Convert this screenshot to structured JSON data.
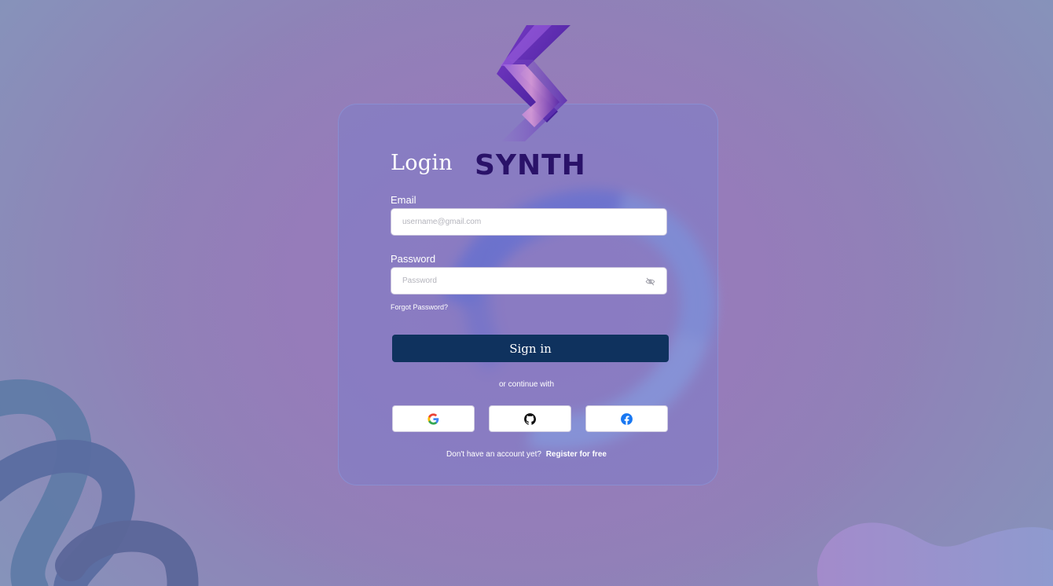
{
  "brand": {
    "name": "SYNTH",
    "logo_icon": "synth-s-logo-icon"
  },
  "login": {
    "title": "Login",
    "email_label": "Email",
    "email_placeholder": "username@gmail.com",
    "password_label": "Password",
    "password_placeholder": "Password",
    "password_toggle_icon": "eye-off-icon",
    "forgot_label": "Forgot Password?",
    "signin_label": "Sign in",
    "or_text": "or continue with",
    "social": [
      {
        "name": "Google",
        "icon": "google-icon"
      },
      {
        "name": "GitHub",
        "icon": "github-icon"
      },
      {
        "name": "Facebook",
        "icon": "facebook-icon"
      }
    ],
    "no_account_text": "Don't have an account yet?",
    "register_label": "Register for free"
  },
  "colors": {
    "primary_button": "#0f325e",
    "brand_text": "#2a1269",
    "background": "#987bbb",
    "card": "#7d7dc8"
  }
}
